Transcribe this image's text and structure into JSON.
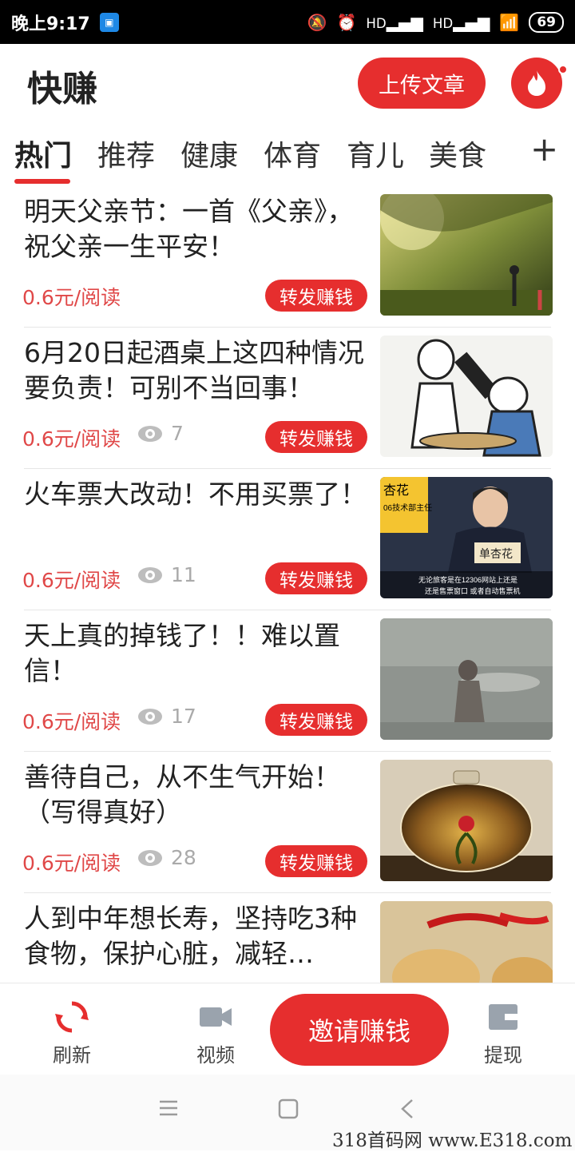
{
  "status_bar": {
    "time": "晚上9:17",
    "battery": "69",
    "network_left": "HD",
    "network_right": "HD"
  },
  "header": {
    "app_title": "快赚",
    "upload_label": "上传文章"
  },
  "tabs": [
    {
      "label": "热门",
      "active": true
    },
    {
      "label": "推荐",
      "active": false
    },
    {
      "label": "健康",
      "active": false
    },
    {
      "label": "体育",
      "active": false
    },
    {
      "label": "育儿",
      "active": false
    },
    {
      "label": "美食",
      "active": false
    }
  ],
  "tab_add_label": "+",
  "articles": [
    {
      "title": "明天父亲节：一首《父亲》，祝父亲一生平安！",
      "price": "0.6元/阅读",
      "views": "",
      "share_label": "转发赚钱",
      "thumb": "forest-scene"
    },
    {
      "title": "6月20日起酒桌上这四种情况要负责！可别不当回事！",
      "price": "0.6元/阅读",
      "views": "7",
      "share_label": "转发赚钱",
      "thumb": "cartoon-drinking"
    },
    {
      "title": "火车票大改动！不用买票了！",
      "price": "0.6元/阅读",
      "views": "11",
      "share_label": "转发赚钱",
      "thumb": "press-conference",
      "thumb_text": {
        "name_tag": "单杏花",
        "side_text": "杏花",
        "side_sub": "06技术部主任",
        "caption1": "无论旅客是在12306网站上还是",
        "caption2": "还是售票窗口 或者自动售票机"
      }
    },
    {
      "title": "天上真的掉钱了！！难以置信！",
      "price": "0.6元/阅读",
      "views": "17",
      "share_label": "转发赚钱",
      "thumb": "blurry-street"
    },
    {
      "title": "善待自己，从不生气开始！（写得真好）",
      "price": "0.6元/阅读",
      "views": "28",
      "share_label": "转发赚钱",
      "thumb": "flower-tea"
    },
    {
      "title": "人到中年想长寿，坚持吃3种食物，保护心脏，减轻…",
      "price": "",
      "views": "",
      "share_label": "",
      "thumb": "potatoes-peppers"
    }
  ],
  "bottom_nav": {
    "refresh": "刷新",
    "video": "视频",
    "invite": "邀请赚钱",
    "withdraw": "提现"
  },
  "watermark": "318首码网 www.E318.com",
  "colors": {
    "accent": "#e62e2e",
    "price": "#e04848"
  }
}
